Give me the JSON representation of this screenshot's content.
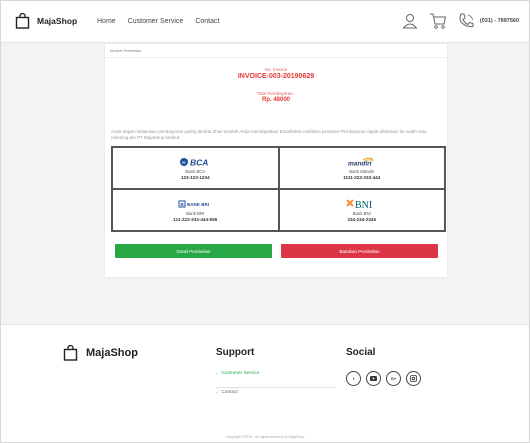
{
  "header": {
    "brand": "MajaShop",
    "nav": [
      "Home",
      "Customer Service",
      "Contact"
    ],
    "phone": "(031) - 7897560"
  },
  "invoice": {
    "section_title": "Invoice Pembelian",
    "no_label": "No. Invoice",
    "number": "INVOICE-003-20190629",
    "total_label": "Total Pembayaran :",
    "total": "Rp. 48000",
    "note": "Anda dapat melakukan pembayaran paling lambat 2hari setelah Anda mendapatkan Email/SMS notifikasi pesanan Pembayaran dapat dilakukan ke salah satu rekening a/n PT MajaShop berikut:"
  },
  "banks": [
    {
      "logo": "BCA",
      "name": "Bank BCA",
      "account": "123-123-1234"
    },
    {
      "logo": "mandiri",
      "name": "Bank Mandiri",
      "account": "1111-222-333-444"
    },
    {
      "logo": "BANK BRI",
      "name": "Bank BRI",
      "account": "111-222-333-444-555"
    },
    {
      "logo": "BNI",
      "name": "Bank BNI",
      "account": "234-234-2345"
    }
  ],
  "buttons": {
    "detail": "Detail Pembelian",
    "cancel": "Batalkan Pembelian"
  },
  "footer": {
    "brand": "MajaShop",
    "support_title": "Support",
    "support_links": [
      "Customer Service",
      "Contact"
    ],
    "social_title": "Social",
    "social_icons": [
      "facebook-icon",
      "youtube-icon",
      "google-plus-icon",
      "instagram-icon"
    ],
    "copyright": "Copyright ©2019 - All rights reserved by MajaShop"
  },
  "colors": {
    "accent_green": "#28a745",
    "accent_red": "#dc3545",
    "invoice_red": "#e53935"
  }
}
